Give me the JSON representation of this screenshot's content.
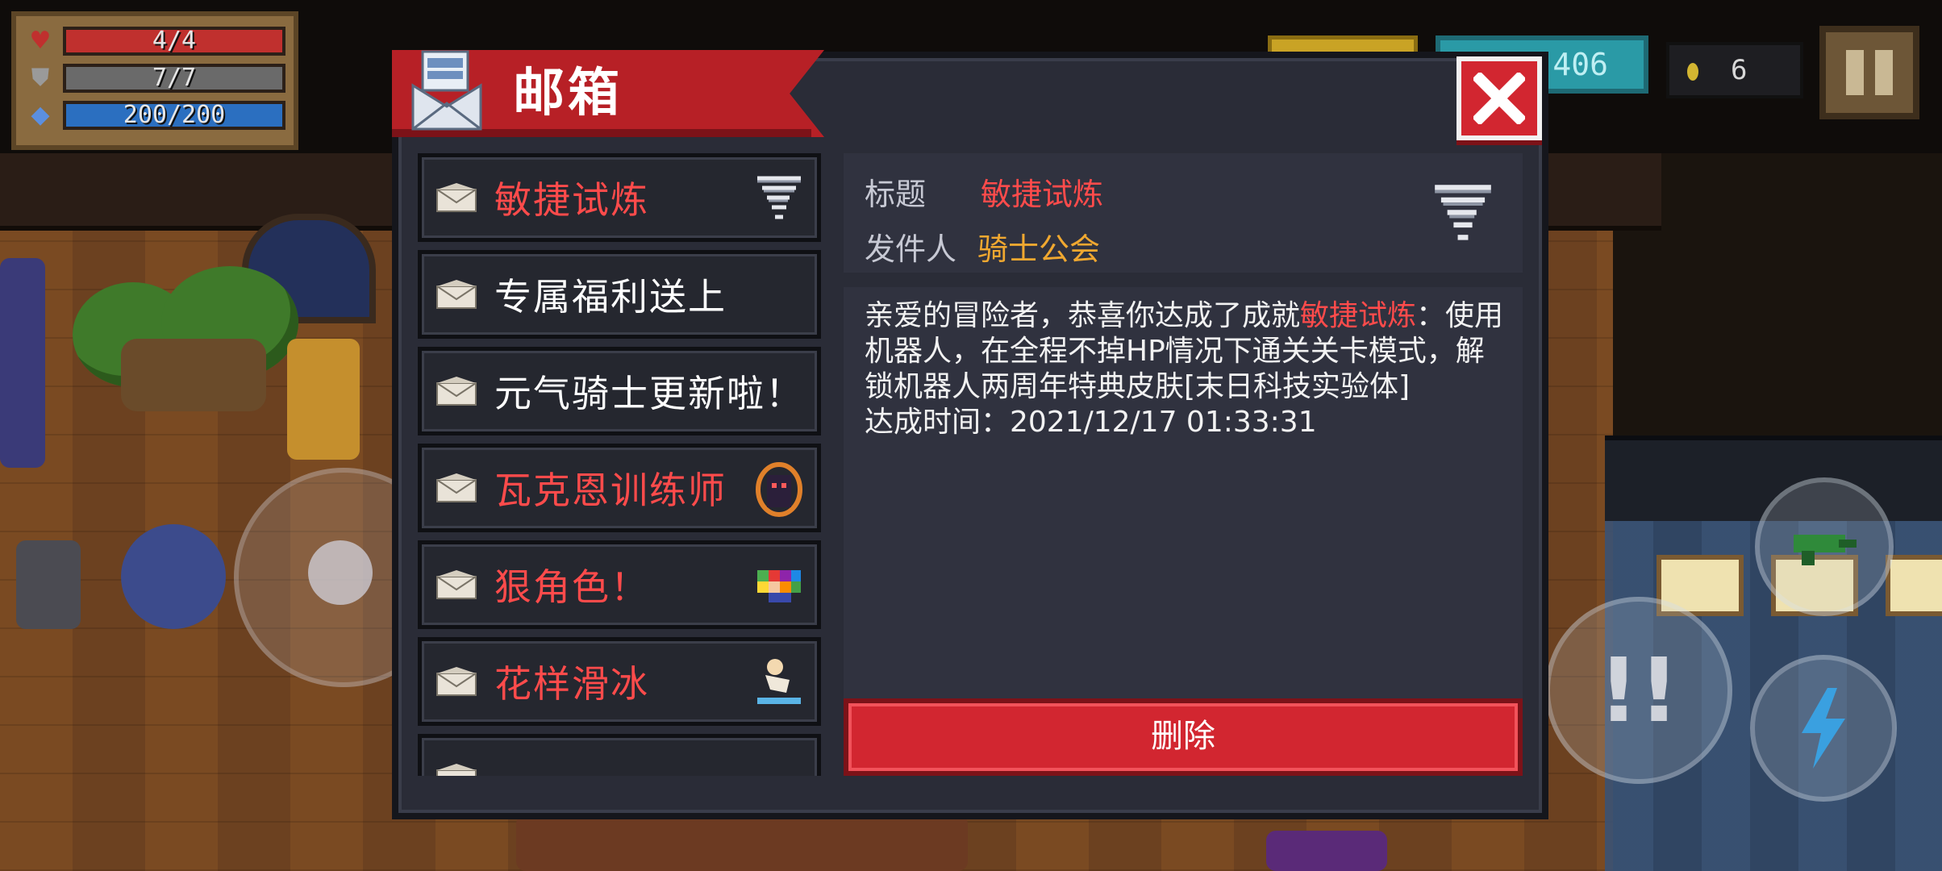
{
  "hud": {
    "health": {
      "value": "4/4",
      "fraction": 1.0,
      "color": "#c0302e"
    },
    "armor": {
      "value": "7/7",
      "fraction": 1.0,
      "color": "#6a6a6a"
    },
    "energy": {
      "value": "200/200",
      "fraction": 1.0,
      "color": "#2b6fc0"
    },
    "gems": "406",
    "coins": "6"
  },
  "mailbox": {
    "title": "邮箱",
    "mails": [
      {
        "label": "敏捷试炼",
        "color": "#ff4b4b",
        "icon": "tornado-icon"
      },
      {
        "label": "专属福利送上",
        "color": "#ffffff",
        "icon": ""
      },
      {
        "label": "元气骑士更新啦！",
        "color": "#ffffff",
        "icon": ""
      },
      {
        "label": "瓦克恩训练师",
        "color": "#ff4b4b",
        "icon": "trainer-portrait-icon"
      },
      {
        "label": "狠角色！",
        "color": "#ff4b4b",
        "icon": "pixel-character-icon"
      },
      {
        "label": "花样滑冰",
        "color": "#ff4b4b",
        "icon": "skater-icon"
      }
    ],
    "detail": {
      "subject_label": "标题",
      "subject": "敏捷试炼",
      "sender_label": "发件人",
      "sender": "骑士公会",
      "body_part1": "亲爱的冒险者，恭喜你达成了成就",
      "body_highlight": "敏捷试炼",
      "body_part2": "：使用机器人，在全程不掉HP情况下通关关卡模式，解锁机器人两周年特典皮肤[末日科技实验体]",
      "achieved_time": "达成时间：2021/12/17 01:33:31",
      "delete_label": "删除"
    }
  },
  "colors": {
    "accent_red": "#d22630",
    "highlight_red": "#ff4b4b",
    "sender_orange": "#f0a830"
  }
}
